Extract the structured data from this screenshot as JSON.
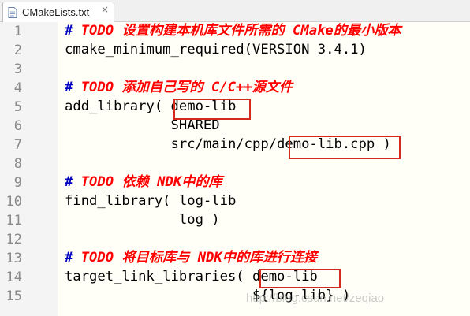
{
  "tab": {
    "title": "CMakeLists.txt",
    "close_glyph": "×"
  },
  "editor": {
    "lines": [
      {
        "number": "1",
        "hash": "#",
        "comment": " TODO 设置构建本机库文件所需的 CMake的最小版本",
        "code": ""
      },
      {
        "number": "2",
        "hash": "",
        "comment": "",
        "code": "cmake_minimum_required(VERSION 3.4.1)"
      },
      {
        "number": "3",
        "hash": "",
        "comment": "",
        "code": ""
      },
      {
        "number": "4",
        "hash": "#",
        "comment": " TODO 添加自己写的 C/C++源文件",
        "code": ""
      },
      {
        "number": "5",
        "hash": "",
        "comment": "",
        "code": "add_library( demo-lib"
      },
      {
        "number": "6",
        "hash": "",
        "comment": "",
        "code": "             SHARED"
      },
      {
        "number": "7",
        "hash": "",
        "comment": "",
        "code": "             src/main/cpp/demo-lib.cpp )"
      },
      {
        "number": "8",
        "hash": "",
        "comment": "",
        "code": ""
      },
      {
        "number": "9",
        "hash": "#",
        "comment": " TODO 依赖 NDK中的库",
        "code": ""
      },
      {
        "number": "10",
        "hash": "",
        "comment": "",
        "code": "find_library( log-lib"
      },
      {
        "number": "11",
        "hash": "",
        "comment": "",
        "code": "              log )"
      },
      {
        "number": "12",
        "hash": "",
        "comment": "",
        "code": ""
      },
      {
        "number": "13",
        "hash": "#",
        "comment": " TODO 将目标库与 NDK中的库进行连接",
        "code": ""
      },
      {
        "number": "14",
        "hash": "",
        "comment": "",
        "code": "target_link_libraries( demo-lib"
      },
      {
        "number": "15",
        "hash": "",
        "comment": "",
        "code": "                       ${log-lib} )"
      }
    ]
  },
  "watermark": "http://blog.csdn.net/zeqiao",
  "colors": {
    "comment": "#ff0000",
    "hash": "#0000c0",
    "highlight_box": "#d42a1e",
    "gutter_bg": "#f4f4f4"
  }
}
